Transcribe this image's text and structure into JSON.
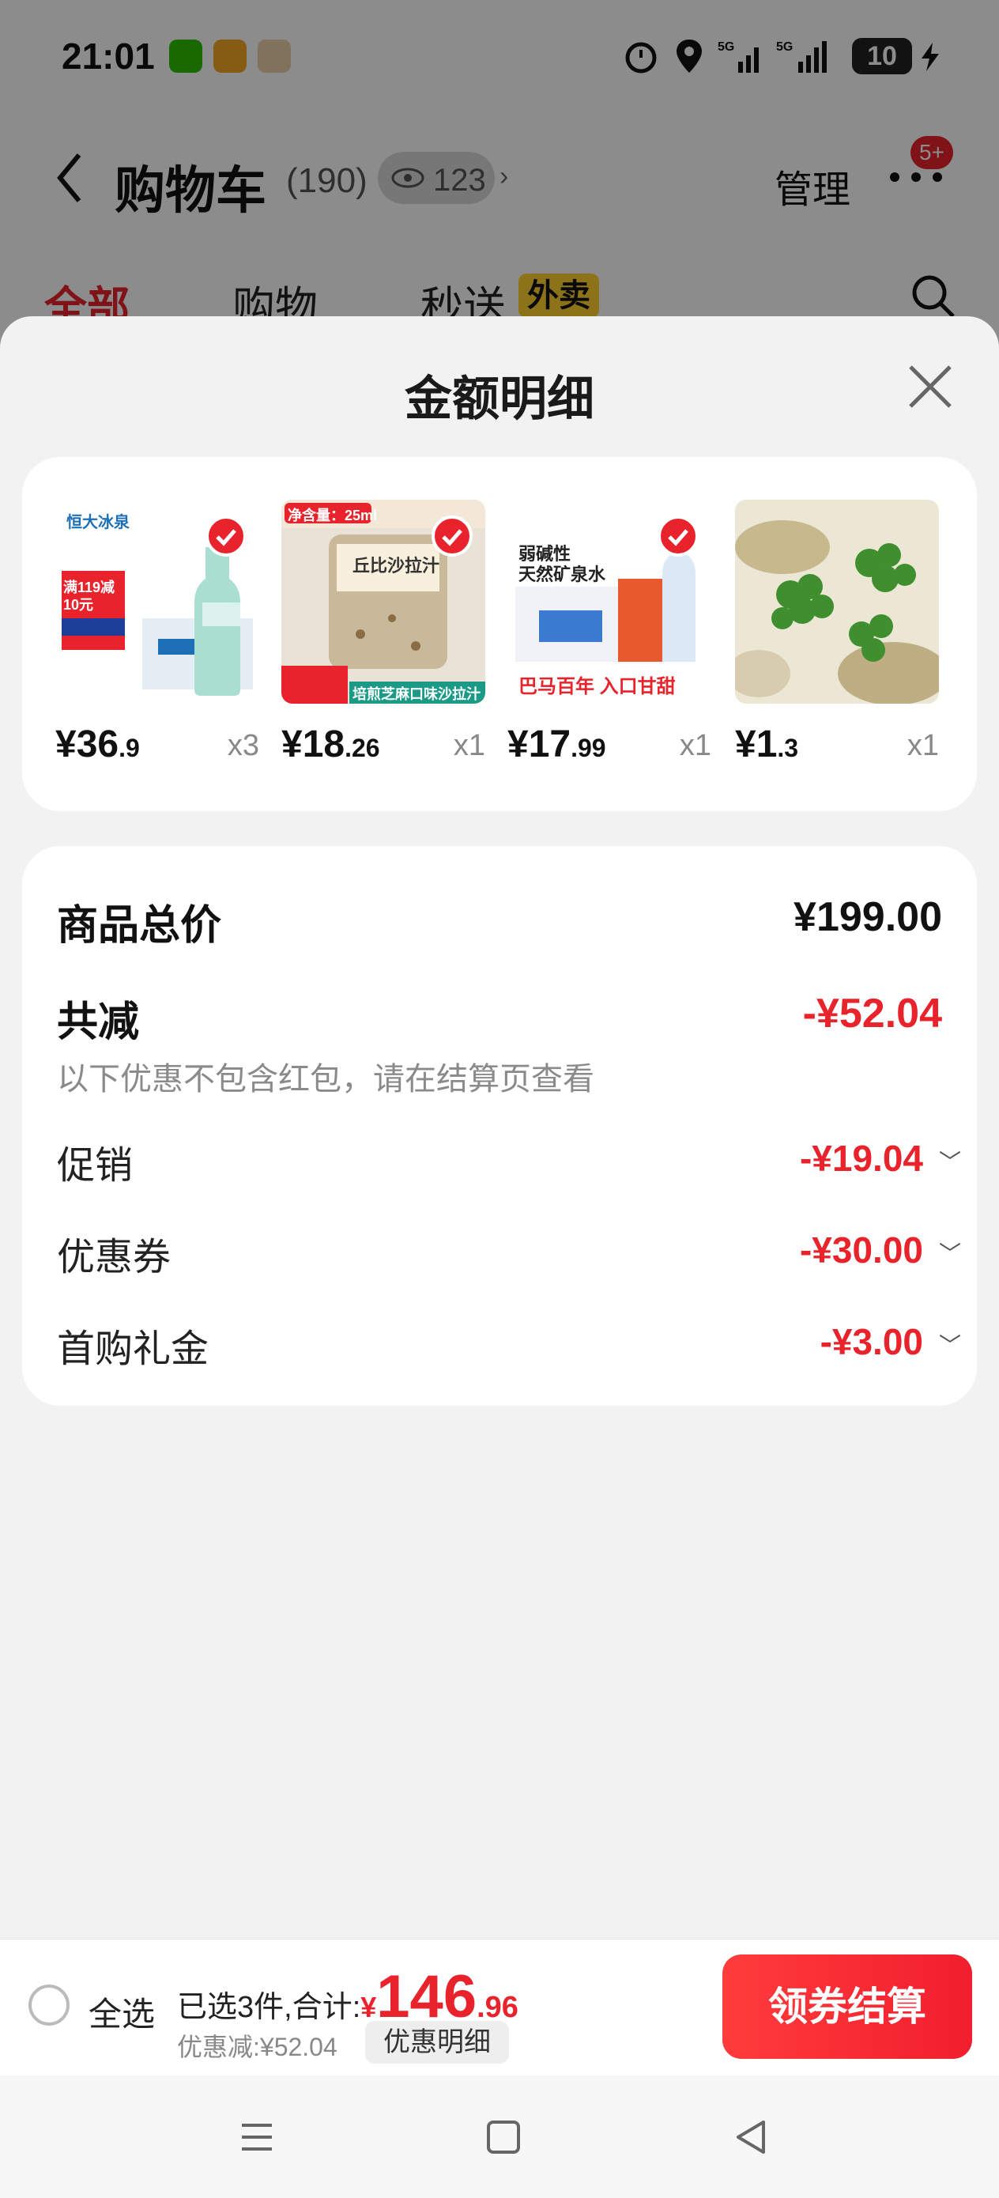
{
  "status_bar": {
    "time": "21:01",
    "battery": "10"
  },
  "header": {
    "title": "购物车",
    "count": "(190)",
    "views": "123",
    "manage": "管理",
    "badge": "5+"
  },
  "tabs": [
    {
      "label": "全部"
    },
    {
      "label": "购物"
    },
    {
      "label": "秒送"
    }
  ],
  "tab_tag": "外卖",
  "sheet": {
    "title": "金额明细"
  },
  "products": [
    {
      "currency": "¥",
      "price_int": "36",
      "price_dec": ".9",
      "qty": "x3",
      "img_text_1": "恒大冰泉",
      "img_text_2": "满119减10元",
      "selected": true
    },
    {
      "currency": "¥",
      "price_int": "18",
      "price_dec": ".26",
      "qty": "x1",
      "img_text_1": "净含量：25ml",
      "img_text_2": "丘比沙拉汁",
      "img_text_3": "培煎芝麻口味沙拉汁",
      "selected": true
    },
    {
      "currency": "¥",
      "price_int": "17",
      "price_dec": ".99",
      "qty": "x1",
      "img_text_1": "弱碱性",
      "img_text_2": "天然矿泉水",
      "img_text_3": "巴马百年 入口甘甜",
      "selected": true
    },
    {
      "currency": "¥",
      "price_int": "1",
      "price_dec": ".3",
      "qty": "x1",
      "selected": false
    }
  ],
  "summary": {
    "total_label": "商品总价",
    "total_value": "¥199.00",
    "discount_label": "共减",
    "discount_value": "-¥52.04",
    "discount_note": "以下优惠不包含红包，请在结算页查看",
    "items": [
      {
        "label": "促销",
        "value": "-¥19.04"
      },
      {
        "label": "优惠券",
        "value": "-¥30.00"
      },
      {
        "label": "首购礼金",
        "value": "-¥3.00"
      }
    ]
  },
  "footer": {
    "select_all": "全选",
    "selected_text": "已选3件,合计:",
    "currency": "¥",
    "total_int": "146",
    "total_dec": ".96",
    "discount_text": "优惠减:¥52.04",
    "detail_button": "优惠明细",
    "checkout_button": "领券结算"
  },
  "colors": {
    "accent": "#e8232b",
    "tag_yellow": "#ffcf2e"
  }
}
